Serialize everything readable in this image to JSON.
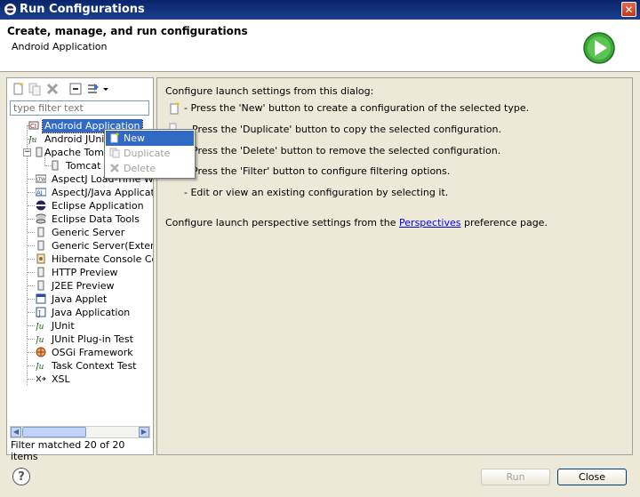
{
  "window": {
    "title": "Run Configurations",
    "close_glyph": "✕",
    "icon": "eclipse-icon"
  },
  "header": {
    "title": "Create, manage, and run configurations",
    "subtitle": "Android Application",
    "icon": "run-large-icon"
  },
  "left_panel": {
    "toolbar": [
      {
        "name": "new-config-button",
        "icon": "new-icon"
      },
      {
        "name": "duplicate-config-button",
        "icon": "duplicate-icon"
      },
      {
        "name": "delete-config-button",
        "icon": "delete-icon"
      },
      {
        "name": "collapse-all-button",
        "icon": "collapse-icon"
      },
      {
        "name": "filter-menu-button",
        "icon": "filter-icon"
      }
    ],
    "filter_placeholder": "type filter text",
    "tree": [
      {
        "label": "Android Application",
        "selected": true
      },
      {
        "label": "Android JUnit"
      },
      {
        "label": "Apache Tomc"
      },
      {
        "label": "Tomcat v6"
      },
      {
        "label": "AspectJ Load-Time We"
      },
      {
        "label": "AspectJ/Java Applicati"
      },
      {
        "label": "Eclipse Application"
      },
      {
        "label": "Eclipse Data Tools"
      },
      {
        "label": "Generic Server"
      },
      {
        "label": "Generic Server(External"
      },
      {
        "label": "Hibernate Console Conf"
      },
      {
        "label": "HTTP Preview"
      },
      {
        "label": "J2EE Preview"
      },
      {
        "label": "Java Applet"
      },
      {
        "label": "Java Application"
      },
      {
        "label": "JUnit"
      },
      {
        "label": "JUnit Plug-in Test"
      },
      {
        "label": "OSGi Framework"
      },
      {
        "label": "Task Context Test"
      },
      {
        "label": "XSL"
      }
    ],
    "status": "Filter matched 20 of 20 items"
  },
  "context_menu": [
    {
      "label": "New",
      "state": "highlighted"
    },
    {
      "label": "Duplicate",
      "state": "disabled"
    },
    {
      "label": "Delete",
      "state": "disabled"
    }
  ],
  "right_panel": {
    "intro": "Configure launch settings from this dialog:",
    "items": [
      "- Press the 'New' button to create a configuration of the selected type.",
      "Press the 'Duplicate' button to copy the selected configuration.",
      "Press the 'Delete' button to remove the selected configuration.",
      "Press the 'Filter' button to configure filtering options.",
      "- Edit or view an existing configuration by selecting it."
    ],
    "perspective_prefix": "Configure launch perspective settings from the",
    "perspective_link": "Perspectives",
    "perspective_suffix": "preference page."
  },
  "buttons": {
    "run": "Run",
    "close": "Close",
    "help_glyph": "?"
  },
  "colors": {
    "title_bar": "#0a246a",
    "selection": "#316ac5",
    "dialog_bg": "#ece9d8",
    "link": "#0000ff"
  }
}
